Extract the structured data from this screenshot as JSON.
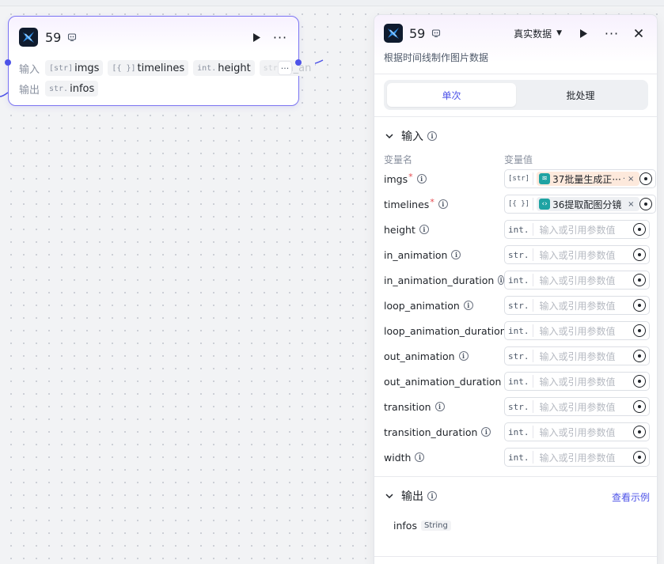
{
  "node": {
    "title": "59",
    "input_label": "输入",
    "output_label": "输出",
    "inputs": [
      {
        "type": "[str]",
        "name": "imgs"
      },
      {
        "type": "[{ }]",
        "name": "timelines"
      },
      {
        "type": "int.",
        "name": "height"
      },
      {
        "type": "str.",
        "name": "in_an"
      }
    ],
    "more_inputs": "···",
    "outputs": [
      {
        "type": "str.",
        "name": "infos"
      }
    ]
  },
  "panel": {
    "title": "59",
    "data_mode": "真实数据",
    "description": "根据时间线制作图片数据",
    "tabs": [
      {
        "label": "单次",
        "active": true
      },
      {
        "label": "批处理",
        "active": false
      }
    ],
    "input_section": {
      "title": "输入",
      "col_name": "变量名",
      "col_value": "变量值",
      "placeholder": "输入或引用参数值",
      "vars": [
        {
          "name": "imgs",
          "required": true,
          "type": "[str]",
          "ref": "37批量生成正···",
          "ref_suffix": "·"
        },
        {
          "name": "timelines",
          "required": true,
          "type": "[{ }]",
          "ref": "36提取配图分镜 · a",
          "ref_suffix": ""
        },
        {
          "name": "height",
          "required": false,
          "type": "int."
        },
        {
          "name": "in_animation",
          "required": false,
          "type": "str."
        },
        {
          "name": "in_animation_duration",
          "required": false,
          "type": "int."
        },
        {
          "name": "loop_animation",
          "required": false,
          "type": "str."
        },
        {
          "name": "loop_animation_duration",
          "required": false,
          "type": "int."
        },
        {
          "name": "out_animation",
          "required": false,
          "type": "str."
        },
        {
          "name": "out_animation_duration",
          "required": false,
          "type": "int."
        },
        {
          "name": "transition",
          "required": false,
          "type": "str."
        },
        {
          "name": "transition_duration",
          "required": false,
          "type": "int."
        },
        {
          "name": "width",
          "required": false,
          "type": "int."
        }
      ]
    },
    "output_section": {
      "title": "输出",
      "see_example": "查看示例",
      "outputs": [
        {
          "name": "infos",
          "type": "String"
        }
      ]
    }
  },
  "colors": {
    "accent": "#4d53e8",
    "node_border": "#7b74f2",
    "required": "#e5484d",
    "ref_chip_icon": "#1fa3a3"
  }
}
